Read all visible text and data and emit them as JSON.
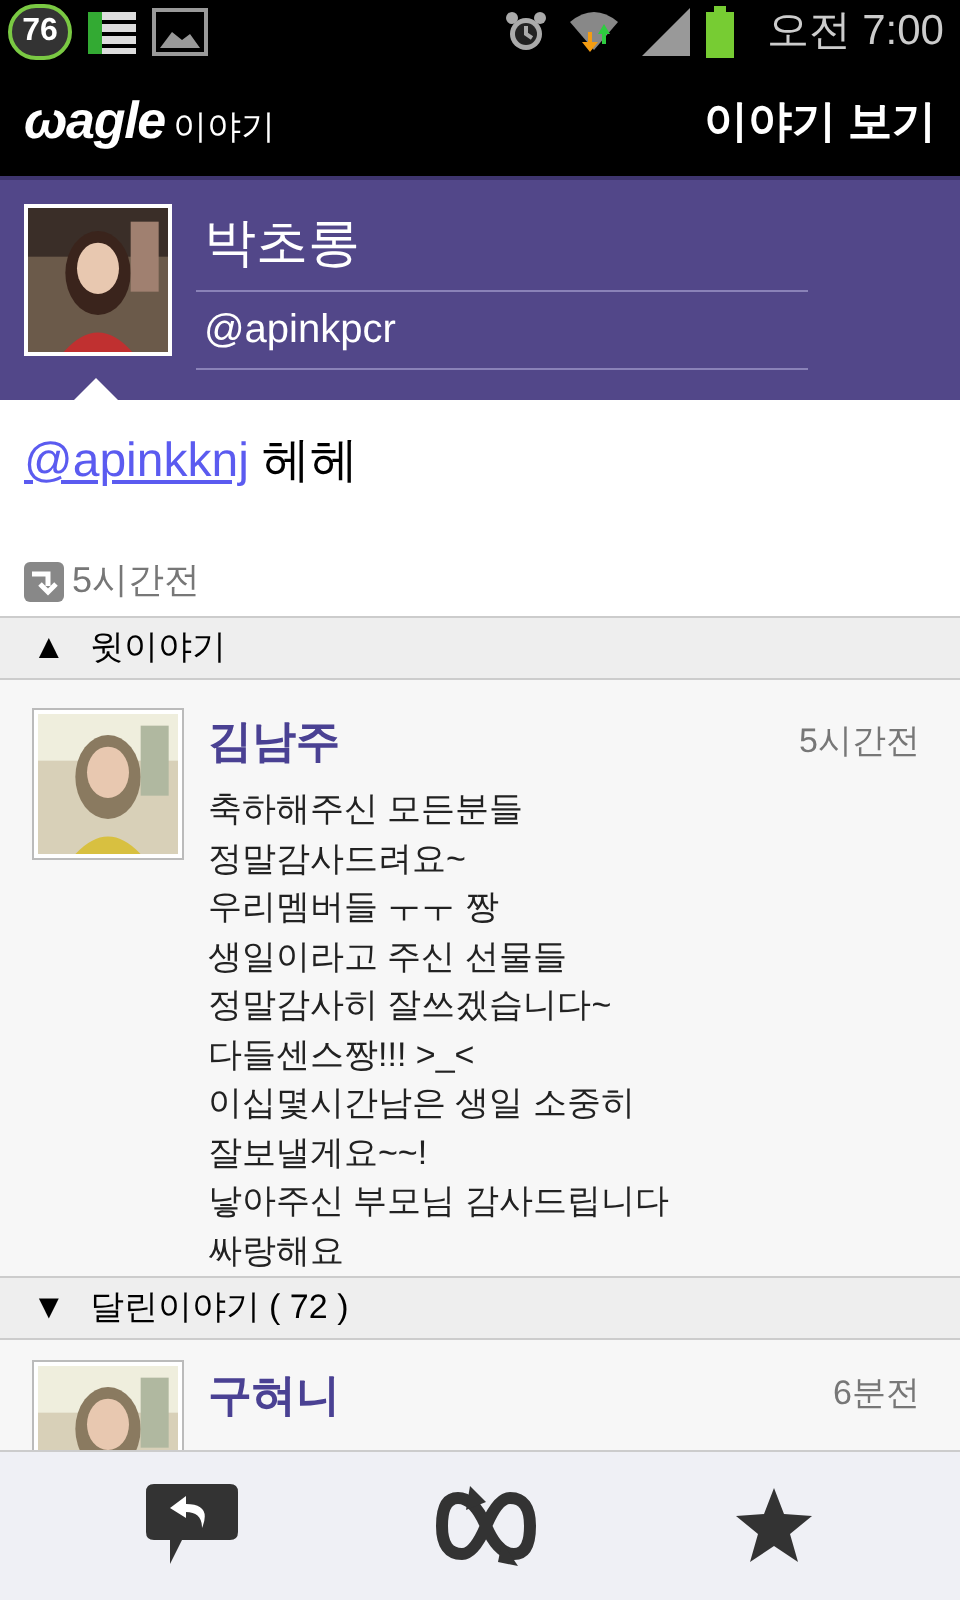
{
  "status_bar": {
    "badge": "76",
    "time": "오전 7:00"
  },
  "app_bar": {
    "logo": "ωagle",
    "logo_suffix": "이야기",
    "title": "이야기 보기"
  },
  "profile": {
    "name": "박초롱",
    "handle": "@apinkpcr"
  },
  "post": {
    "mention": "@apinkknj",
    "text": "헤헤",
    "time": "5시간전"
  },
  "parent_section": {
    "toggle": "▲",
    "label": "윗이야기"
  },
  "parent_post": {
    "author": "김남주",
    "time": "5시간전",
    "lines": [
      "축하해주신 모든분들",
      "정말감사드려요~",
      "우리멤버들 ㅜㅜ 짱",
      "생일이라고 주신 선물들",
      "정말감사히 잘쓰겠습니다~",
      "다들센스짱!!! >_<",
      "이십몇시간남은 생일 소중히",
      "잘보낼게요~~!",
      "낳아주신 부모님 감사드립니다",
      "싸랑해요"
    ]
  },
  "replies_section": {
    "toggle": "▼",
    "label": "달린이야기 ( 72 )"
  },
  "replies": [
    {
      "author": "구혀니",
      "time": "6분전"
    }
  ]
}
